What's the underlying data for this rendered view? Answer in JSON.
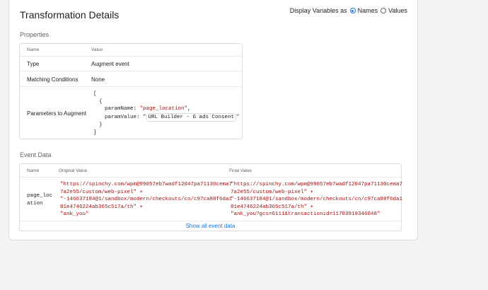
{
  "header": {
    "title": "Transformation Details",
    "display_label": "Display Variables as",
    "options": [
      "Names",
      "Values"
    ],
    "selected": "Names"
  },
  "properties": {
    "heading": "Properties",
    "columns": [
      "Name",
      "Value"
    ],
    "rows": [
      {
        "name": "Type",
        "value": "Augment event"
      },
      {
        "name": "Matching Conditions",
        "value": "None"
      },
      {
        "name": "Parameters to Augment",
        "value": ""
      }
    ],
    "params_code": {
      "open_bracket": "[",
      "open_brace": "{",
      "param_name_key": "paramName: ",
      "param_name_value": "\"page_location\"",
      "param_name_comma": ",",
      "param_value_key": "paramValue: ",
      "quote_open": "\"",
      "param_value_chip": "URL Builder - G ads Consent",
      "quote_close": "\"",
      "close_brace": "}",
      "close_bracket": "]"
    }
  },
  "event_data": {
    "heading": "Event Data",
    "columns": [
      "Name",
      "Original Value",
      "Final Value"
    ],
    "row": {
      "name_line1": "page_loc",
      "name_line2": "ation",
      "original": [
        "\"https://spinchy.com/wpm@99057eb7wadf12047pa71130cema7",
        "7a2e55/custom/web-pixel\" +",
        "\"-146637184@1/sandbox/modern/checkouts/cn/c97ca88f6da1",
        "81e4746224ab365c517a/th\" +",
        "\"ank_you\""
      ],
      "final": [
        "\"https://spinchy.com/wpm@99057eb7wadf12047pa71130cema7",
        "7a2e55/custom/web-pixel\" +",
        "\"-146637184@1/sandbox/modern/checkouts/cn/c97ca88f6da1",
        "81e4746224ab365c517a/th\" +",
        "\"ank_you?gcs=G111&transactionid=11703919346048\""
      ]
    },
    "show_all_label": "Show all event data"
  }
}
